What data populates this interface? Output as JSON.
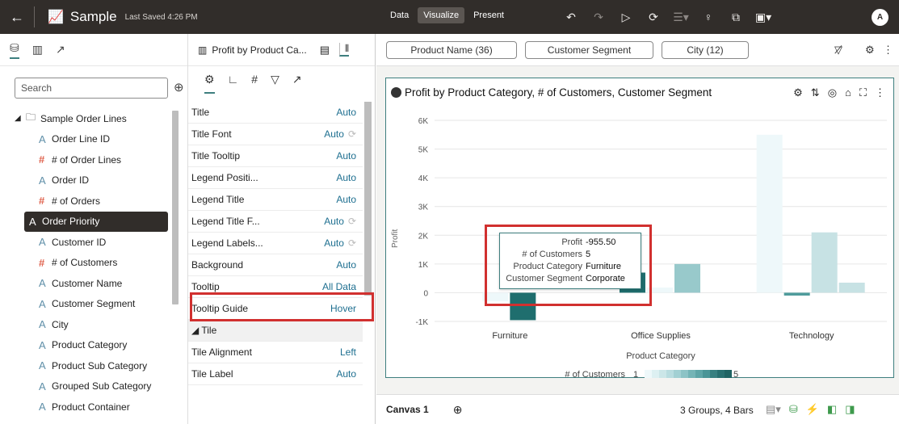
{
  "header": {
    "title": "Sample",
    "saved": "Last Saved 4:26 PM",
    "modes": [
      "Data",
      "Visualize",
      "Present"
    ],
    "active_mode": "Visualize",
    "tools": [
      "undo-icon",
      "redo-icon",
      "play-icon",
      "refresh-icon",
      "comments-icon",
      "lightbulb-icon",
      "export-icon",
      "save-icon"
    ],
    "avatar": "A"
  },
  "left": {
    "search_placeholder": "Search",
    "tree_root": "Sample Order Lines",
    "items": [
      {
        "type": "A",
        "label": "Order Line ID"
      },
      {
        "type": "#",
        "label": "# of Order Lines"
      },
      {
        "type": "A",
        "label": "Order ID"
      },
      {
        "type": "#",
        "label": "# of Orders"
      },
      {
        "type": "A",
        "label": "Order Priority",
        "selected": true
      },
      {
        "type": "A",
        "label": "Customer ID"
      },
      {
        "type": "#",
        "label": "# of Customers"
      },
      {
        "type": "A",
        "label": "Customer Name"
      },
      {
        "type": "A",
        "label": "Customer Segment"
      },
      {
        "type": "A",
        "label": "City"
      },
      {
        "type": "A",
        "label": "Product Category"
      },
      {
        "type": "A",
        "label": "Product Sub Category"
      },
      {
        "type": "A",
        "label": "Grouped Sub Category"
      },
      {
        "type": "A",
        "label": "Product Container"
      }
    ]
  },
  "middle": {
    "viz_name": "Profit by Product Ca...",
    "properties": [
      {
        "label": "Title",
        "value": "Auto"
      },
      {
        "label": "Title Font",
        "value": "Auto",
        "refresh": true
      },
      {
        "label": "Title Tooltip",
        "value": "Auto"
      },
      {
        "label": "Legend Positi...",
        "value": "Auto"
      },
      {
        "label": "Legend Title",
        "value": "Auto"
      },
      {
        "label": "Legend Title F...",
        "value": "Auto",
        "refresh": true
      },
      {
        "label": "Legend Labels...",
        "value": "Auto",
        "refresh": true
      },
      {
        "label": "Background",
        "value": "Auto"
      },
      {
        "label": "Tooltip",
        "value": "All Data",
        "highlight": true
      },
      {
        "label": "Tooltip Guide",
        "value": "Hover"
      },
      {
        "label": "◢ Tile",
        "value": "",
        "section": true
      },
      {
        "label": "Tile Alignment",
        "value": "Left"
      },
      {
        "label": "Tile Label",
        "value": "Auto"
      }
    ]
  },
  "filters": [
    "Product Name (36)",
    "Customer Segment",
    "City (12)"
  ],
  "viz": {
    "title": "Profit by Product Category, # of Customers, Customer Segment",
    "legend_title": "# of Customers",
    "legend_min": "1",
    "legend_max": "5",
    "tooltip": {
      "rows": [
        {
          "k": "Profit",
          "v": "-955.50"
        },
        {
          "k": "# of Customers",
          "v": "5"
        },
        {
          "k": "Product Category",
          "v": "Furniture"
        },
        {
          "k": "Customer Segment",
          "v": "Corporate"
        }
      ]
    }
  },
  "chart_data": {
    "type": "bar",
    "categories": [
      "Furniture",
      "Office Supplies",
      "Technology"
    ],
    "xlabel": "Product Category",
    "ylabel": "Profit",
    "ylim": [
      -1000,
      6000
    ],
    "yticks": [
      "6K",
      "5K",
      "4K",
      "3K",
      "2K",
      "1K",
      "0",
      "-1K"
    ],
    "yvalues": [
      6000,
      5000,
      4000,
      3000,
      2000,
      1000,
      0,
      -1000
    ],
    "bars": [
      {
        "category": "Furniture",
        "value": -300,
        "customers": 1
      },
      {
        "category": "Furniture",
        "value": -955.5,
        "customers": 5
      },
      {
        "category": "Office Supplies",
        "value": 700,
        "customers": 5
      },
      {
        "category": "Office Supplies",
        "value": 180,
        "customers": 1
      },
      {
        "category": "Office Supplies",
        "value": 1000,
        "customers": 3
      },
      {
        "category": "Technology",
        "value": 5500,
        "customers": 1
      },
      {
        "category": "Technology",
        "value": -100,
        "customers": 4
      },
      {
        "category": "Technology",
        "value": 2100,
        "customers": 2
      },
      {
        "category": "Technology",
        "value": 350,
        "customers": 2
      }
    ]
  },
  "bottom": {
    "canvas_tab": "Canvas 1",
    "info": "3 Groups, 4 Bars"
  }
}
